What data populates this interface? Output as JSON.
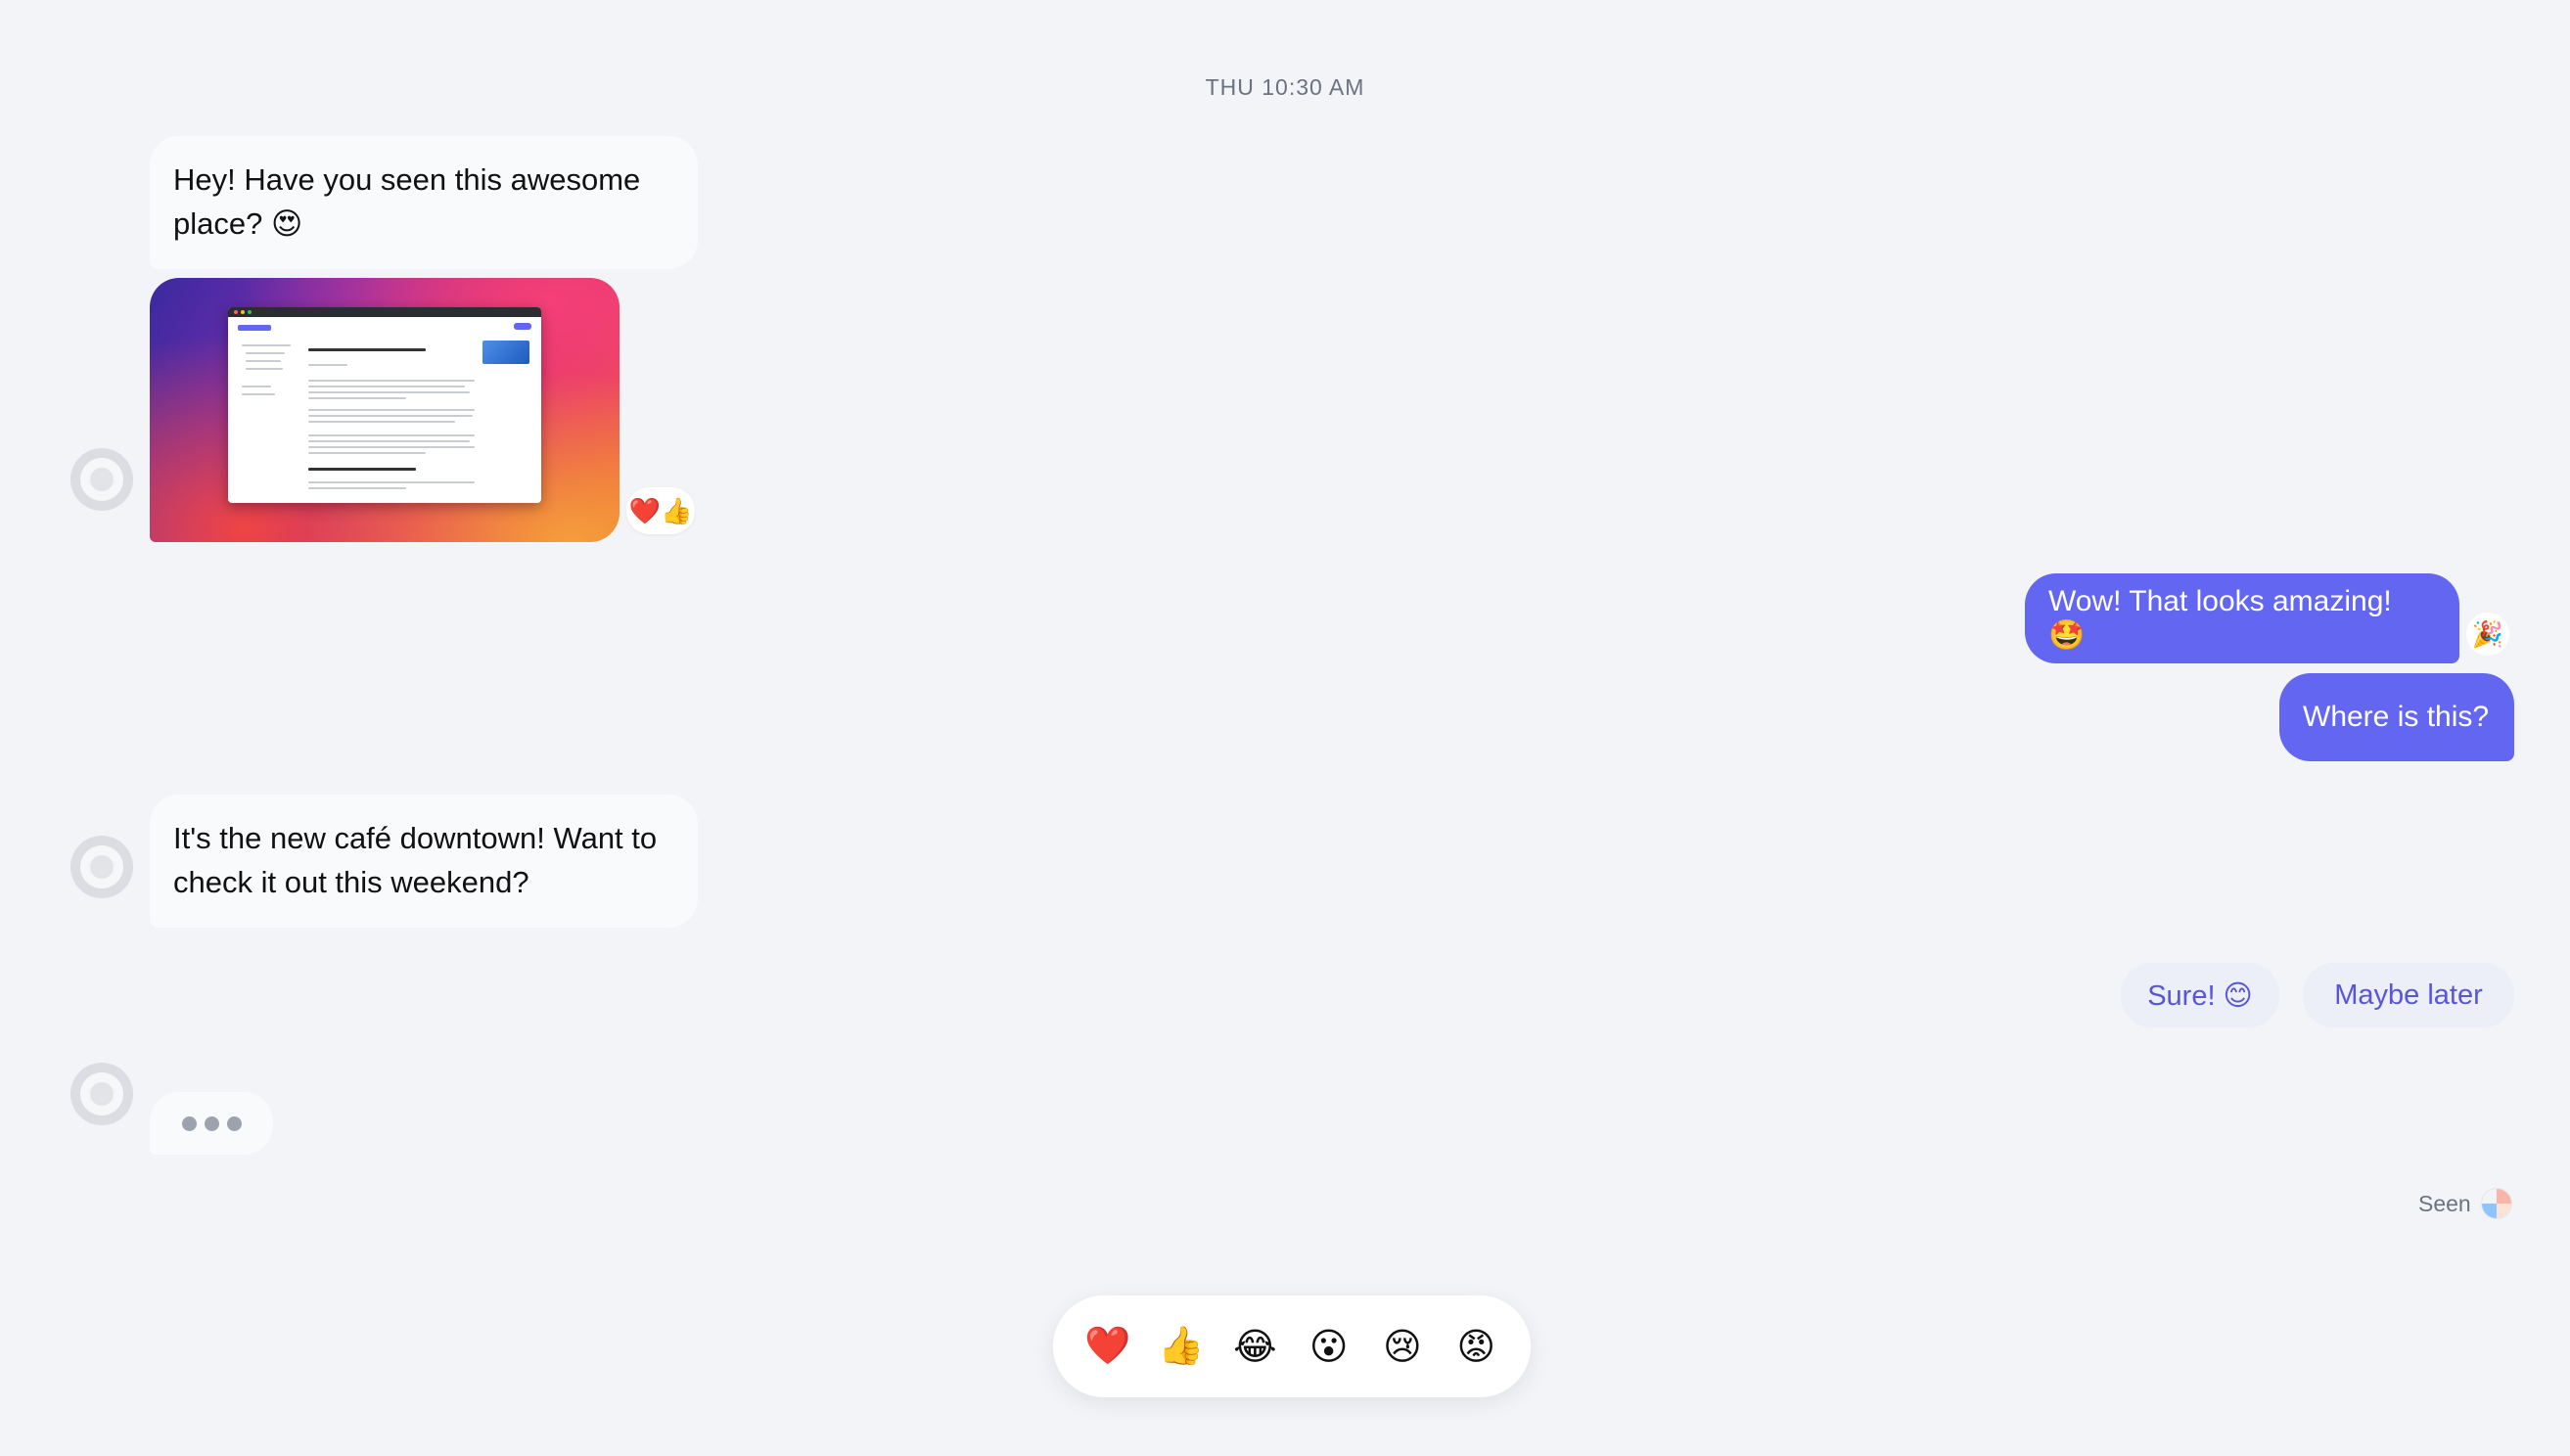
{
  "timestamp": "THU 10:30 AM",
  "messages": {
    "m1": {
      "text": "Hey! Have you seen this awesome place? 😍"
    },
    "m1_image": {
      "reactions": "❤️👍"
    },
    "m2": {
      "text": "Wow! That looks amazing! 🤩",
      "reaction": "🎉"
    },
    "m3": {
      "text": "Where is this?"
    },
    "m4": {
      "text": "It's the new café downtown! Want to check it out this weekend?"
    }
  },
  "quick_replies": [
    "Sure! 😊",
    "Maybe later"
  ],
  "seen": {
    "label": "Seen"
  },
  "emoji_bar": [
    "❤️",
    "👍",
    "😂",
    "😮",
    "😢",
    "😡"
  ],
  "colors": {
    "background": "#f3f4f7",
    "outgoing_bubble": "#6366f1",
    "incoming_bubble": "#f9fafb",
    "quick_reply_text": "#5856d6"
  }
}
